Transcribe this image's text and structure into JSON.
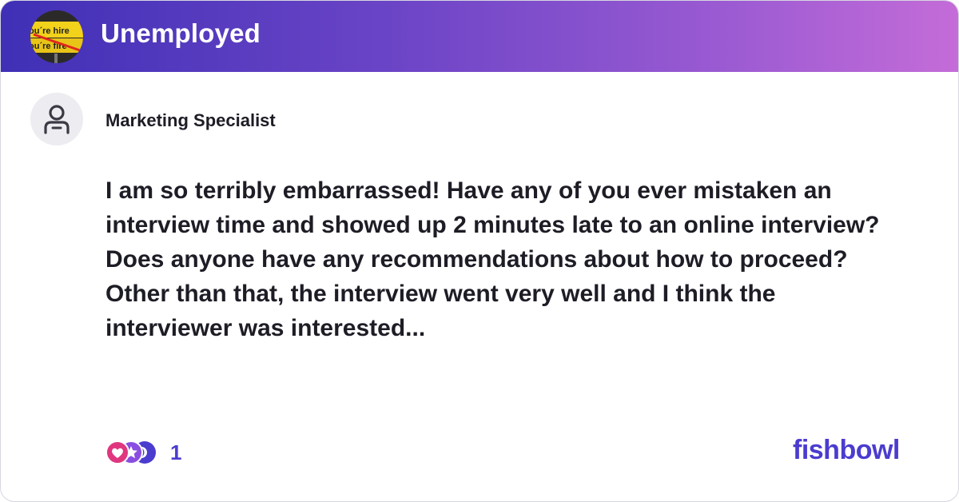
{
  "bowl": {
    "name": "Unemployed",
    "avatar_text_top": "ou´re hire",
    "avatar_text_bottom": "ou´re fire"
  },
  "post": {
    "author_title": "Marketing Specialist",
    "body": "I am so terribly embarrassed! Have any of you ever mistaken an interview time and showed up 2 minutes late to an online interview? Does anyone have any recommendations about how to proceed? Other than that, the interview went very well and I think the interviewer was interested...",
    "reaction_count": "1",
    "reaction_icons": [
      "heart-reaction-icon",
      "star-reaction-icon",
      "moon-reaction-icon"
    ]
  },
  "brand": {
    "logo_text": "fishbowl",
    "accent_color": "#4b3ccf",
    "gradient_start": "#3f30b6",
    "gradient_end": "#c46cd8"
  }
}
